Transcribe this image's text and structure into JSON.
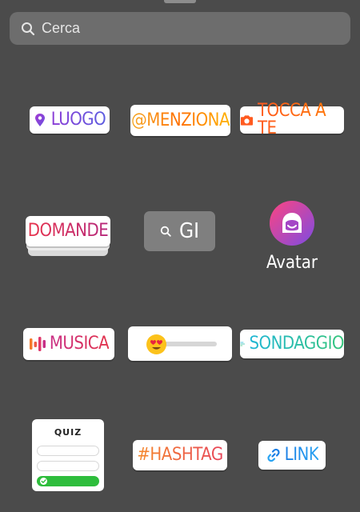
{
  "search": {
    "placeholder": "Cerca"
  },
  "stickers": {
    "luogo": "LUOGO",
    "menziona": "@MENZIONA",
    "tocca_a_te": "TOCCA A TE",
    "domande": "DOMANDE",
    "gif": "GI",
    "avatar": "Avatar",
    "musica": "MUSICA",
    "sondaggio": "SONDAGGIO",
    "quiz": "QUIZ",
    "hashtag": "#HASHTAG",
    "link": "LINK"
  },
  "emoji_slider": {
    "level": 0.15
  },
  "icons": [
    "search-icon",
    "location-pin-icon",
    "camera-icon",
    "search-icon",
    "avatar-face-icon",
    "music-bars-icon",
    "heart-eyes-emoji-icon",
    "poll-lines-icon",
    "check-icon",
    "link-icon"
  ],
  "colors": {
    "background": "#4b4b4b",
    "search_bg": "#6d6d6d",
    "sticker_bg": "#ffffff"
  }
}
